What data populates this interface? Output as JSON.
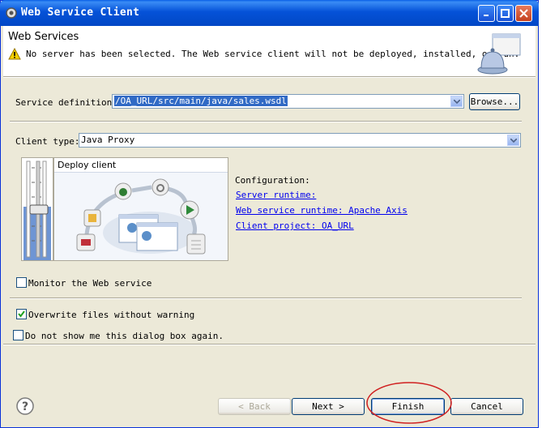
{
  "window": {
    "title": "Web Service Client"
  },
  "header": {
    "title": "Web Services",
    "warning": "No server has been selected. The Web service client will not be deployed, installed, or run."
  },
  "service_definition": {
    "label": "Service definition:",
    "value": "/OA_URL/src/main/java/sales.wsdl",
    "browse_label": "Browse..."
  },
  "client_type": {
    "label": "Client type:",
    "value": "Java Proxy"
  },
  "slider": {
    "caption": "Deploy client"
  },
  "configuration": {
    "heading": "Configuration:",
    "server_runtime": "Server runtime:",
    "web_service_runtime": "Web service runtime: Apache Axis",
    "client_project": "Client project: OA_URL"
  },
  "options": {
    "monitor": "Monitor the Web service",
    "overwrite": "Overwrite files without warning",
    "do_not_show": "Do not show me this dialog box again."
  },
  "buttons": {
    "back": "< Back",
    "next": "Next >",
    "finish": "Finish",
    "cancel": "Cancel"
  },
  "colors": {
    "titlebar": "#0147c5",
    "link": "#0000ee",
    "highlight_oval": "#d02020",
    "selection": "#316ac5"
  }
}
